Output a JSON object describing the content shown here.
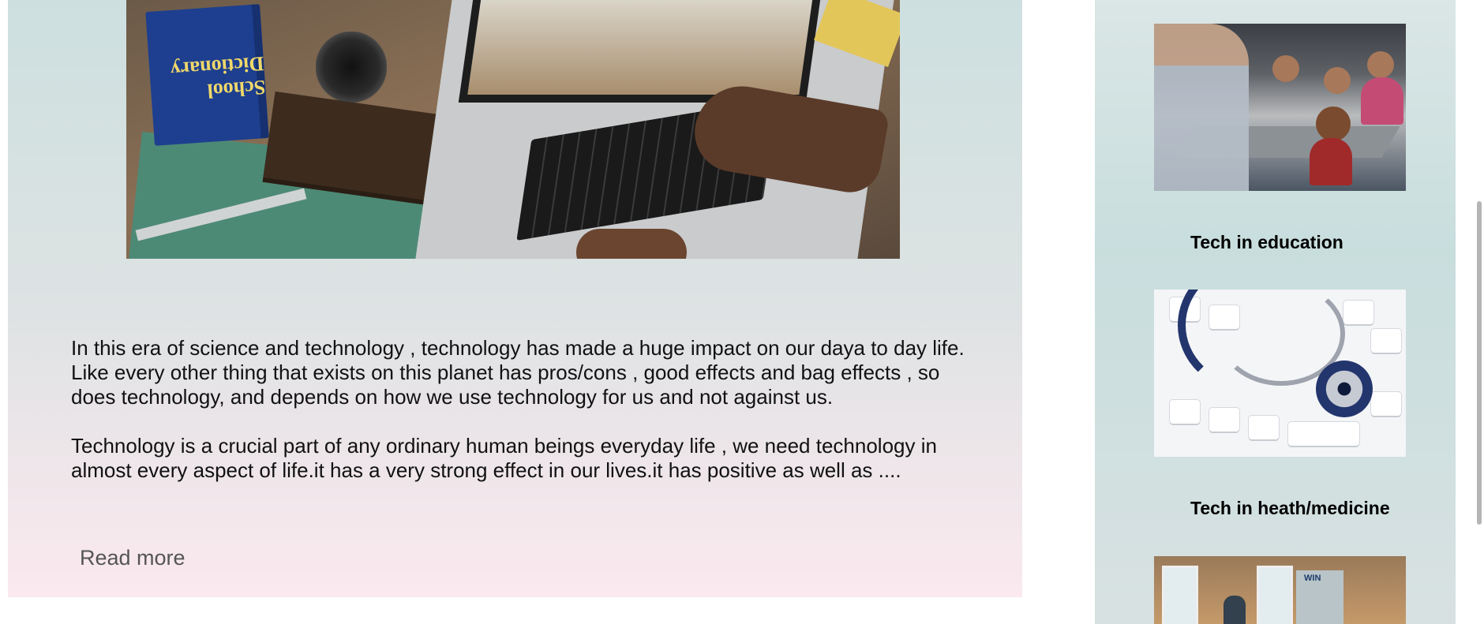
{
  "article": {
    "hero_image": "laptop-on-desk-with-school-supplies",
    "paragraphs": [
      "In this era of science and technology , technology has made a huge impact on our daya to day life. Like every other thing that exists on this planet has pros/cons , good effects and bag effects , so does technology, and depends on how we use technology for us and not against us.",
      "Technology is a crucial part of any ordinary human beings everyday life , we need technology in almost every aspect of life.it has a very strong effect in our lives.it has positive as well as ...."
    ],
    "read_more": "Read more",
    "book_title": "School Dictionary",
    "colors": {
      "gradient_top": "#cde0df",
      "gradient_bottom": "#fbe9ef",
      "text": "#111111",
      "link": "#555555"
    }
  },
  "sidebar": {
    "cards": [
      {
        "image": "classroom-students-with-laptops",
        "title": "Tech in education"
      },
      {
        "image": "stethoscope-on-keyboard",
        "title": "Tech in heath/medicine"
      },
      {
        "image": "office-workspace",
        "title": ""
      }
    ],
    "office_sign": "WIN"
  }
}
